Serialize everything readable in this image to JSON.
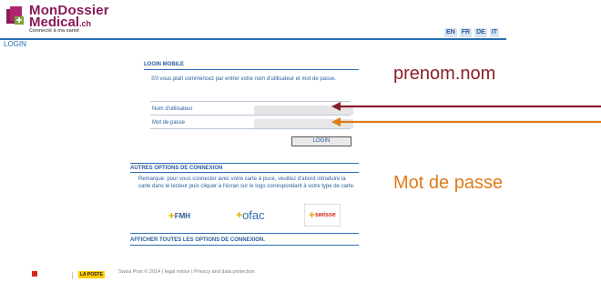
{
  "header": {
    "brand_line1": "MonDossier",
    "brand_line2": "Medical",
    "brand_suffix": ".ch",
    "tagline": "Connecté à ma santé",
    "languages": [
      "EN",
      "FR",
      "DE",
      "IT"
    ]
  },
  "breadcrumb": "LOGIN",
  "login_mobile": {
    "title": "LOGIN MOBILE",
    "instructions": "S'il vous plaît commencez par entrer votre nom d'utilisateur et mot de passe.",
    "username_label": "Nom d'utilisateur",
    "password_label": "Mot de passe",
    "username_value": "",
    "password_value": "",
    "login_button": "LOGIN"
  },
  "other_options": {
    "title": "AUTRES OPTIONS DE CONNEXION",
    "text": "Remarque: pour vous connecter avec votre carte à puce, veuillez d'abord introduire la carte dans le lecteur puis cliquer à l'écran sur le logo correspondant à votre type de carte.",
    "cards": [
      "FMH",
      "ofac",
      "swisse"
    ]
  },
  "show_all": "AFFICHER TOUTES LES OPTIONS DE CONNEXION.",
  "annotations": {
    "username_hint": "prenom.nom",
    "password_hint": "Mot de passe"
  },
  "footer": {
    "text": "Swiss Post © 2014 | legal notice | Privacy and data protection",
    "logo_post": "LA POSTE"
  },
  "colors": {
    "brand": "#8a1a5a",
    "accent_blue": "#2a6fb2",
    "arrow_red": "#8a1f2a",
    "arrow_orange": "#e07b18"
  }
}
